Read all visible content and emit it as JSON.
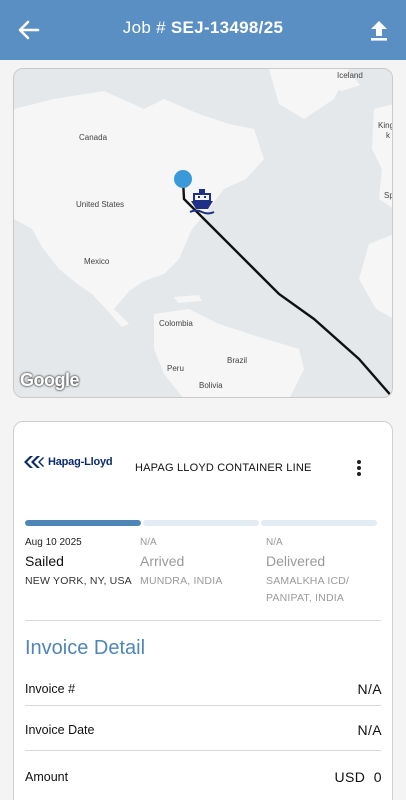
{
  "header": {
    "title_prefix": "Job #",
    "job_number": "SEJ-13498/25"
  },
  "map": {
    "labels": {
      "iceland": "Iceland",
      "kingdom": "King",
      "kingdom2": "k",
      "canada": "Canada",
      "united_states": "United States",
      "mexico": "Mexico",
      "colombia": "Colombia",
      "peru": "Peru",
      "brazil": "Brazil",
      "bolivia": "Bolivia",
      "spain": "Sp"
    },
    "attribution": "Google",
    "route_color": "#111111",
    "origin_marker_color": "#3a9ad9",
    "ship_icon": "ship-icon"
  },
  "shipment": {
    "carrier_logo_text": "Hapag-Lloyd",
    "carrier_name": "HAPAG LLOYD CONTAINER LINE",
    "progress": [
      1.0,
      0.0,
      0.0
    ],
    "accent_color": "#4f86b8",
    "stages": [
      {
        "date": "Aug 10 2025",
        "status": "Sailed",
        "location": "NEW YORK, NY, USA"
      },
      {
        "date": "N/A",
        "status": "Arrived",
        "location": "MUNDRA, INDIA"
      },
      {
        "date": "N/A",
        "status": "Delivered",
        "location": "SAMALKHA ICD/ PANIPAT, INDIA"
      }
    ]
  },
  "invoice": {
    "section_title": "Invoice Detail",
    "rows": [
      {
        "label": "Invoice #",
        "value": "N/A"
      },
      {
        "label": "Invoice Date",
        "value": "N/A"
      },
      {
        "label": "Amount",
        "value": "USD  0"
      }
    ]
  }
}
